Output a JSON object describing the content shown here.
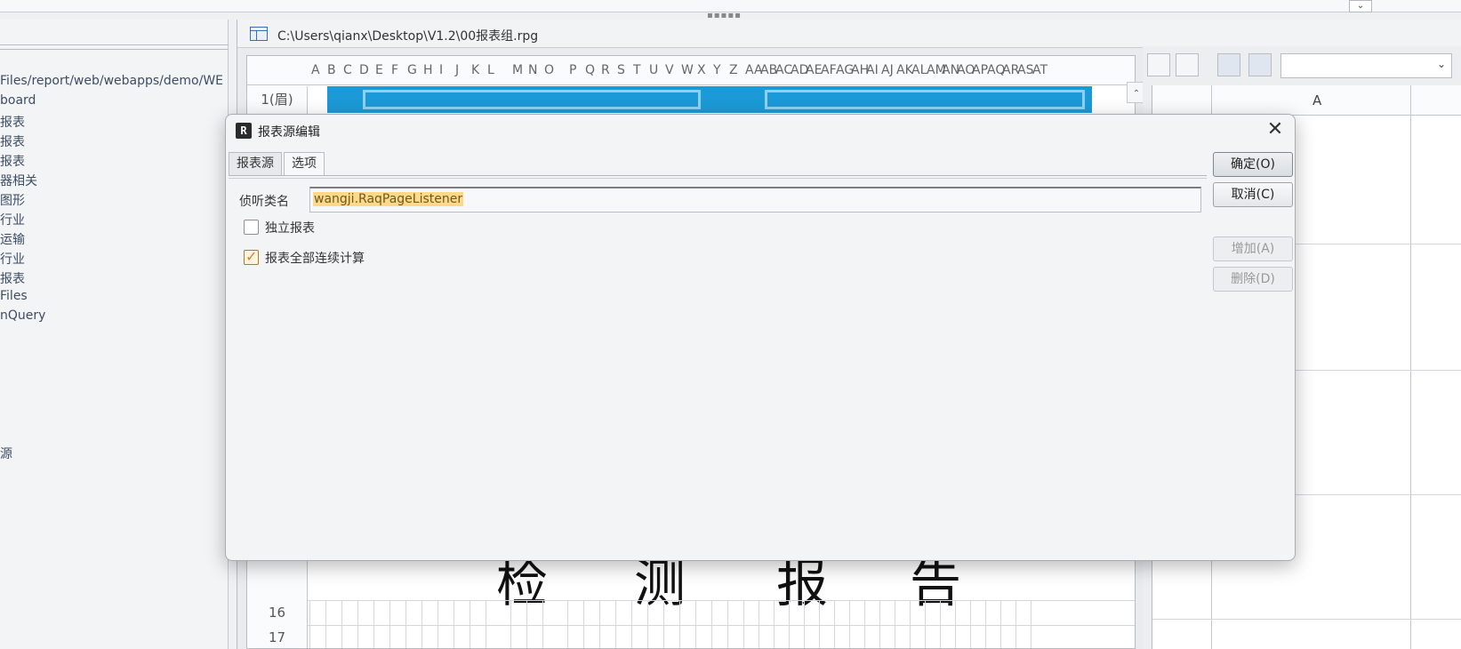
{
  "tree": {
    "items": [
      "Files/report/web/webapps/demo/WE",
      "board",
      "报表",
      "报表",
      "报表",
      "器相关",
      "图形",
      "行业",
      "运输",
      "行业",
      "报表",
      "Files",
      "nQuery",
      "源"
    ]
  },
  "editor": {
    "path": "C:\\Users\\qianx\\Desktop\\V1.2\\00报表组.rpg",
    "columns": [
      "A",
      "B",
      "C",
      "D",
      "E",
      "F",
      "G",
      "H",
      "I",
      "J",
      "K",
      "L",
      "M",
      "N",
      "O",
      "P",
      "Q",
      "R",
      "S",
      "T",
      "U",
      "V",
      "W",
      "X",
      "Y",
      "Z",
      "AA",
      "AB",
      "AC",
      "AD",
      "AE",
      "AF",
      "AG",
      "AH",
      "AI",
      "AJ",
      "AK",
      "AL",
      "AM",
      "AN",
      "AO",
      "AP",
      "AQ",
      "AR",
      "AS",
      "AT"
    ],
    "rows": {
      "first": "1(眉)",
      "r16": "16",
      "r17": "17"
    },
    "big_chars": [
      "检",
      "测",
      "报",
      "告"
    ]
  },
  "right_panel": {
    "column_header": "A"
  },
  "dialog": {
    "title": "报表源编辑",
    "tabs": [
      "报表源",
      "选项"
    ],
    "active_tab": "选项",
    "listener_label": "侦听类名",
    "listener_value": "wangji.RaqPageListener",
    "independent_label": "独立报表",
    "independent_checked": false,
    "continuous_label": "报表全部连续计算",
    "continuous_checked": true,
    "buttons": {
      "ok": "确定(O)",
      "cancel": "取消(C)",
      "add": "增加(A)",
      "delete": "删除(D)"
    }
  }
}
